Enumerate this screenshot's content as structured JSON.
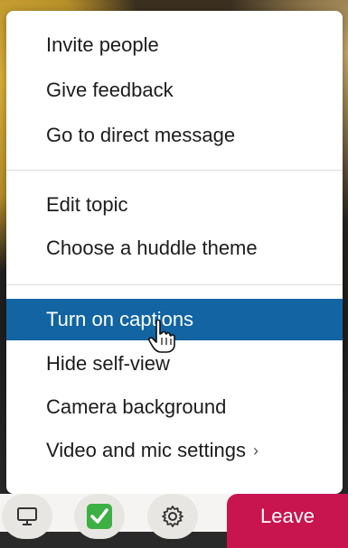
{
  "menu": {
    "group1": [
      "Invite people",
      "Give feedback",
      "Go to direct message"
    ],
    "group2": [
      "Edit topic",
      "Choose a huddle theme"
    ],
    "group3": [
      "Turn on captions",
      "Hide self-view",
      "Camera background",
      "Video and mic settings"
    ],
    "highlighted_item": "Turn on captions",
    "submenu_chevron": "›"
  },
  "toolbar": {
    "share_screen_icon": "monitor-icon",
    "reaction_icon": "checkmark-emoji-icon",
    "settings_icon": "gear-icon",
    "leave_label": "Leave"
  },
  "colors": {
    "highlight": "#1264a3",
    "leave": "#c8144f",
    "check_emoji": "#3cb043"
  }
}
